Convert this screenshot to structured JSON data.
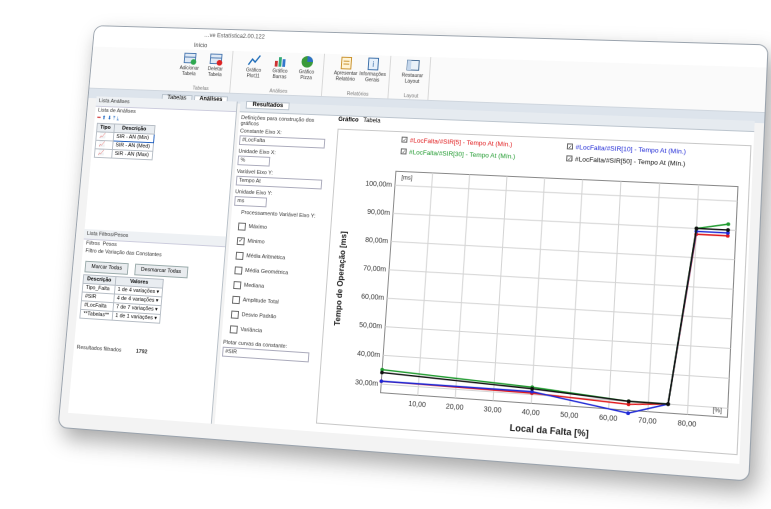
{
  "window": {
    "title": "…ve Estatística2.00.122"
  },
  "ribbon": {
    "tab": "Início",
    "groups": [
      {
        "name": "Tabelas",
        "buttons": [
          "Adicionar Tabela",
          "Deletar Tabela"
        ]
      },
      {
        "name": "Análises",
        "buttons": [
          "Gráfico Plot11",
          "Gráfico Barras",
          "Gráfico Pizza"
        ]
      },
      {
        "name": "Relatórios",
        "buttons": [
          "Apresentar Relatório",
          "Informações Gerais"
        ]
      },
      {
        "name": "Layout",
        "buttons": [
          "Restaurar Layout"
        ]
      }
    ]
  },
  "doc_tabs": [
    "Tabelas",
    "Análises"
  ],
  "left_panel": {
    "title": "Lista Análises",
    "subtitle": "Lista de Análises",
    "columns": [
      "Tipo",
      "Descrição"
    ],
    "rows": [
      "SIR - AN (Min)",
      "SIR - AN (Med)",
      "SIR - AN (Max)"
    ],
    "filters_title": "Lista Filtros/Pesos",
    "filter_tabs": [
      "Filtros",
      "Pesos"
    ],
    "filter_label": "Filtro de Variação das Constantes",
    "mark_all": "Marcar Todas",
    "unmark_all": "Desmarcar Todas",
    "filter_columns": [
      "Descrição",
      "Valores"
    ],
    "filter_rows": [
      {
        "desc": "Tipo_Falta",
        "val": "1 de 4 variações"
      },
      {
        "desc": "#SIR",
        "val": "4 de 4 variações"
      },
      {
        "desc": "#LocFalta",
        "val": "7 de 7 variações"
      },
      {
        "desc": "**Tabelas**",
        "val": "1 de 1 variações"
      }
    ],
    "filtered_label": "Resultados filtrados",
    "filtered_count": "1792"
  },
  "results": {
    "tab": "Resultados",
    "section": "Definições para construção dos gráficos",
    "view_tabs": [
      "Gráfico",
      "Tabela"
    ],
    "const_x_label": "Constante Eixo X:",
    "const_x_value": "#LocFalta",
    "unit_x_label": "Unidade Eixo X:",
    "unit_x_value": "%",
    "var_y_label": "Variável Eixo Y:",
    "var_y_value": "Tempo At",
    "unit_y_label": "Unidade Eixo Y:",
    "unit_y_value": "ms",
    "proc_label": "Processamento Variável Eixo Y:",
    "options": [
      {
        "label": "Máximo",
        "checked": false
      },
      {
        "label": "Mínimo",
        "checked": true
      },
      {
        "label": "Média Aritmética",
        "checked": false
      },
      {
        "label": "Média Geométrica",
        "checked": false
      },
      {
        "label": "Mediana",
        "checked": false
      },
      {
        "label": "Amplitude Total",
        "checked": false
      },
      {
        "label": "Desvio Padrão",
        "checked": false
      },
      {
        "label": "Variância",
        "checked": false
      }
    ],
    "plot_const_label": "Plotar curvas da constante:",
    "plot_const_value": "#SIR"
  },
  "chart_data": {
    "type": "line",
    "xlabel": "Local da Falta [%]",
    "ylabel": "Tempo de Operação [ms]",
    "y_unit_tag": "[ms]",
    "x_unit_tag": "[%]",
    "xticks": [
      "10,00",
      "20,00",
      "30,00",
      "40,00",
      "50,00",
      "60,00",
      "70,00",
      "80,00"
    ],
    "yticks": [
      "30,00m",
      "40,00m",
      "50,00m",
      "60,00m",
      "70,00m",
      "80,00m",
      "90,00m",
      "100,00m"
    ],
    "xlim": [
      0,
      90
    ],
    "ylim": [
      27,
      105
    ],
    "grid": true,
    "legend_position": "top",
    "series": [
      {
        "name": "#LocFalta/#SIR[5] - Tempo At (Mín.)",
        "color": "#e0191b",
        "x": [
          0,
          40,
          65,
          75,
          80,
          88
        ],
        "y": [
          31,
          30.5,
          29,
          30,
          88,
          88
        ]
      },
      {
        "name": "#LocFalta/#SIR[10] - Tempo At (Mín.)",
        "color": "#1f29d6",
        "x": [
          0,
          40,
          65,
          75,
          80,
          88
        ],
        "y": [
          31,
          31,
          26,
          30,
          89,
          89
        ]
      },
      {
        "name": "#LocFalta/#SIR[30] - Tempo At (Mín.)",
        "color": "#1f9a2e",
        "x": [
          0,
          40,
          65,
          75,
          80,
          88
        ],
        "y": [
          35,
          32.5,
          30,
          30,
          90,
          92
        ]
      },
      {
        "name": "#LocFalta/#SIR[50] - Tempo At (Mín.)",
        "color": "#111111",
        "x": [
          0,
          40,
          65,
          75,
          80,
          88
        ],
        "y": [
          34,
          32,
          30,
          30,
          90,
          90
        ]
      }
    ]
  }
}
